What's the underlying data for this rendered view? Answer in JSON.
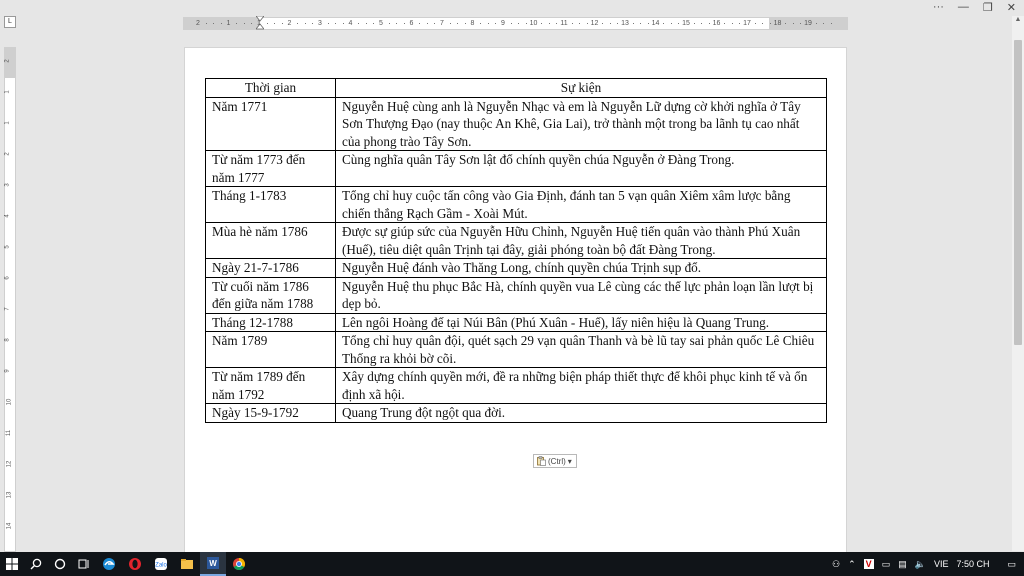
{
  "window": {
    "minimize": "—",
    "restore": "❐",
    "close": "✕",
    "more": "···"
  },
  "ruler": {
    "corner": "L",
    "h_labels": [
      "2",
      "1",
      "1",
      "2",
      "3",
      "4",
      "5",
      "6",
      "7",
      "8",
      "9",
      "10",
      "11",
      "12",
      "13",
      "14",
      "15",
      "16",
      "17",
      "18",
      "19"
    ],
    "v_labels": [
      "2",
      "1",
      "1",
      "2",
      "3",
      "4",
      "5",
      "6",
      "7",
      "8",
      "9",
      "10",
      "11",
      "12",
      "13",
      "14"
    ]
  },
  "table": {
    "headers": [
      "Thời gian",
      "Sự kiện"
    ],
    "rows": [
      {
        "time": "Năm 1771",
        "event": "Nguyễn Huệ cùng anh là Nguyễn Nhạc và em là Nguyễn Lữ dựng cờ khởi nghĩa ở Tây Sơn Thượng Đạo (nay thuộc An Khê, Gia Lai), trở thành một trong ba lãnh tụ cao nhất của phong trào Tây Sơn."
      },
      {
        "time": "Từ năm 1773 đến năm 1777",
        "event": "Cùng nghĩa quân Tây Sơn lật đổ chính quyền chúa Nguyễn ở Đàng Trong."
      },
      {
        "time": "Tháng 1-1783",
        "event": "Tổng chỉ huy cuộc tấn công vào Gia Định, đánh tan 5 vạn quân Xiêm xâm lược bằng chiến thắng Rạch Gầm - Xoài Mút."
      },
      {
        "time": "Mùa hè năm 1786",
        "event": "Được sự giúp sức của Nguyễn Hữu Chỉnh, Nguyễn Huệ tiến quân vào thành Phú Xuân (Huế), tiêu diệt quân Trịnh tại đây, giải phóng toàn bộ đất Đàng Trong."
      },
      {
        "time": "Ngày 21-7-1786",
        "event": "Nguyễn Huệ đánh vào Thăng Long, chính quyền chúa Trịnh sụp đổ."
      },
      {
        "time": "Từ cuối năm 1786 đến giữa năm 1788",
        "event": "Nguyễn Huệ thu phục Bắc Hà, chính quyền vua Lê cùng các thế lực phản loạn lần lượt bị dẹp bỏ."
      },
      {
        "time": "Tháng 12-1788",
        "event": "Lên ngôi Hoàng đế tại Núi Bân (Phú Xuân - Huế), lấy niên hiệu là Quang Trung."
      },
      {
        "time": "Năm 1789",
        "event": "Tổng chỉ huy quân đội, quét sạch 29 vạn quân Thanh và bè lũ tay sai phản quốc Lê Chiêu Thống ra khỏi bờ cõi."
      },
      {
        "time": "Từ năm 1789 đến năm 1792",
        "event": "Xây dựng chính quyền mới, đề ra những biện pháp thiết thực để khôi phục kinh tế và ổn định xã hội."
      },
      {
        "time": "Ngày 15-9-1792",
        "event": "Quang Trung đột ngột qua đời."
      }
    ]
  },
  "paste_options": {
    "label": "(Ctrl)"
  },
  "taskbar": {
    "language": "VIE",
    "time": "7:50 CH"
  },
  "colors": {
    "taskbar": "#101418",
    "page": "#ffffff",
    "background": "#e6e6e6"
  }
}
